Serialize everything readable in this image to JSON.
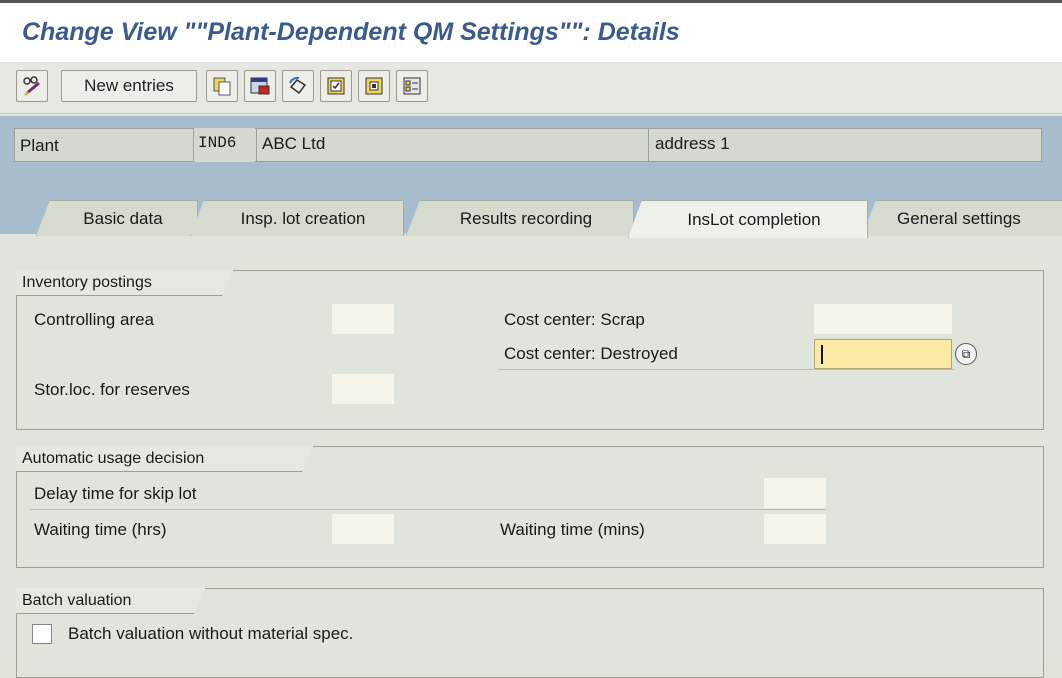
{
  "window": {
    "title": "Change View \"\"Plant-Dependent QM Settings\"\": Details"
  },
  "toolbar": {
    "new_entries_label": "New entries",
    "icons": [
      "pencil-glasses-icon",
      "copy-icon",
      "delete-icon",
      "undo-icon",
      "select-all-icon",
      "select-block-icon",
      "deselect-all-icon"
    ]
  },
  "header": {
    "plant_label": "Plant",
    "plant_code": "IND6",
    "plant_name": "ABC Ltd",
    "plant_address": "address 1"
  },
  "tabs": [
    {
      "label": "Basic data"
    },
    {
      "label": "Insp. lot creation"
    },
    {
      "label": "Results recording"
    },
    {
      "label": "InsLot completion",
      "active": true
    },
    {
      "label": "General settings"
    }
  ],
  "inventory_postings": {
    "title": "Inventory postings",
    "controlling_area_label": "Controlling area",
    "controlling_area_value": "",
    "stor_loc_label": "Stor.loc. for reserves",
    "stor_loc_value": "",
    "cost_center_scrap_label": "Cost center: Scrap",
    "cost_center_scrap_value": "",
    "cost_center_destroyed_label": "Cost center: Destroyed",
    "cost_center_destroyed_value": ""
  },
  "automatic_usage_decision": {
    "title": "Automatic usage decision",
    "delay_skip_lot_label": "Delay time for skip lot",
    "waiting_hrs_label": "Waiting time (hrs)",
    "waiting_mins_label": "Waiting time (mins)"
  },
  "batch_valuation": {
    "title": "Batch valuation",
    "checkbox_label": "Batch valuation without material spec.",
    "checked": false
  },
  "colors": {
    "title": "#3b5a8e",
    "header_bg": "#a7bccd",
    "focus_field": "#fbe9a6"
  }
}
